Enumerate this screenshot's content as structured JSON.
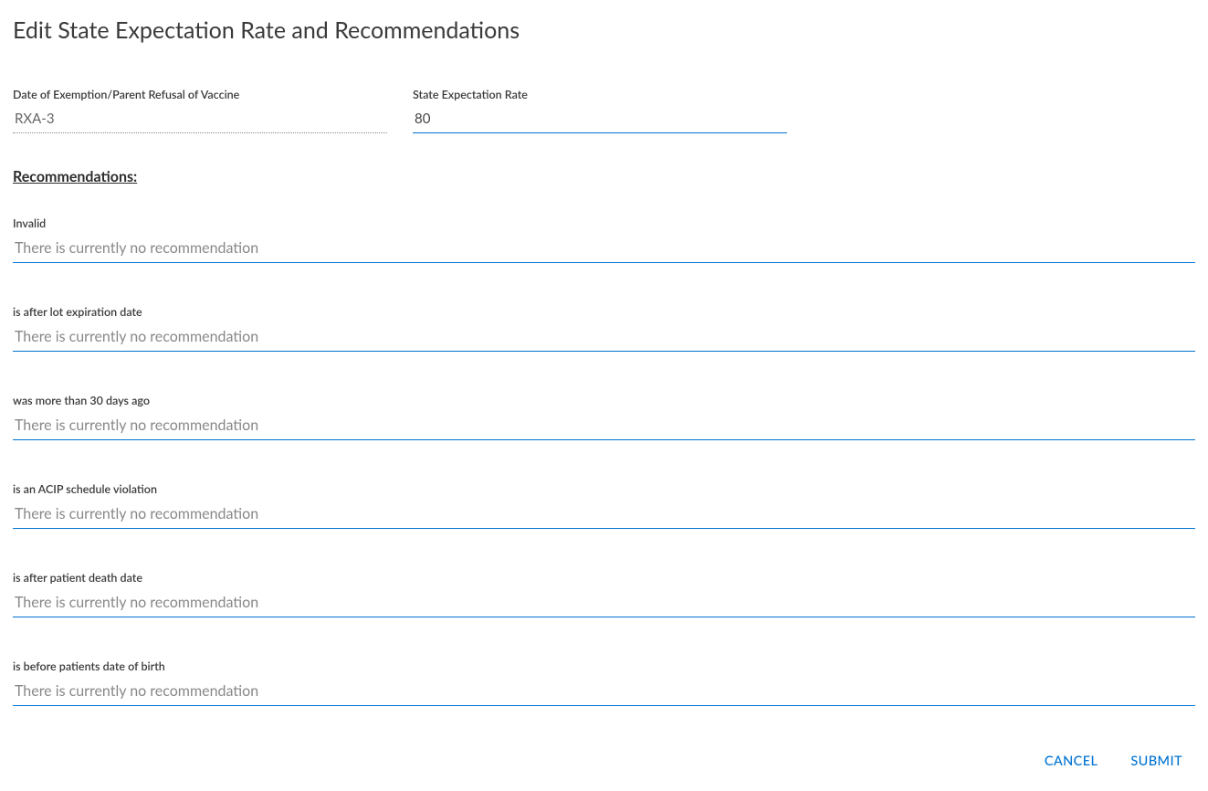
{
  "title": "Edit State Expectation Rate and Recommendations",
  "exemption": {
    "label": "Date of Exemption/Parent Refusal of Vaccine",
    "value": "RXA-3"
  },
  "rate": {
    "label": "State Expectation Rate",
    "value": "80"
  },
  "recommendations_heading": "Recommendations:",
  "recommendation_placeholder": "There is currently no recommendation",
  "recommendations": [
    {
      "label": "Invalid",
      "value": ""
    },
    {
      "label": "is after lot expiration date",
      "value": ""
    },
    {
      "label": "was more than 30 days ago",
      "value": ""
    },
    {
      "label": "is an ACIP schedule violation",
      "value": ""
    },
    {
      "label": "is after patient death date",
      "value": ""
    },
    {
      "label": "is before patients date of birth",
      "value": ""
    }
  ],
  "buttons": {
    "cancel": "CANCEL",
    "submit": "SUBMIT"
  }
}
